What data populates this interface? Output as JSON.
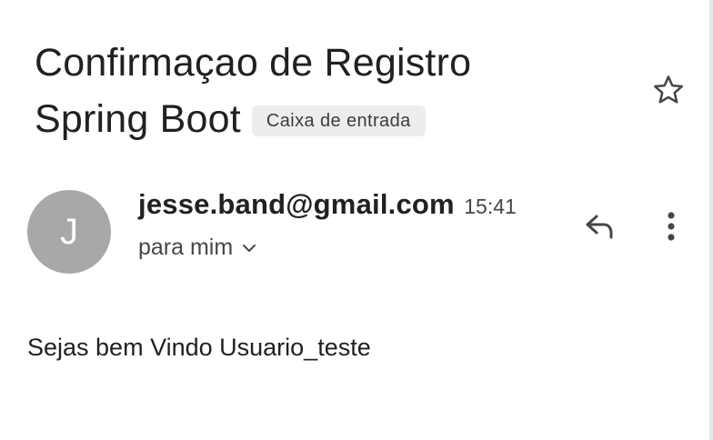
{
  "message": {
    "subject_line1": "Confirmaçao de Registro",
    "subject_line2": "Spring Boot",
    "label": "Caixa de entrada",
    "sender_initial": "J",
    "sender_email": "jesse.band@gmail.com",
    "time": "15:41",
    "recipient": "para mim",
    "body": "Sejas bem Vindo Usuario_teste"
  },
  "icons": {
    "star": "star-outline-icon",
    "reply": "reply-icon",
    "more": "more-vertical-icon",
    "chevron": "chevron-down-icon"
  },
  "colors": {
    "avatar_bg": "#a8a8a8",
    "label_bg": "#ededed",
    "text_primary": "#202124",
    "text_secondary": "#444746"
  }
}
